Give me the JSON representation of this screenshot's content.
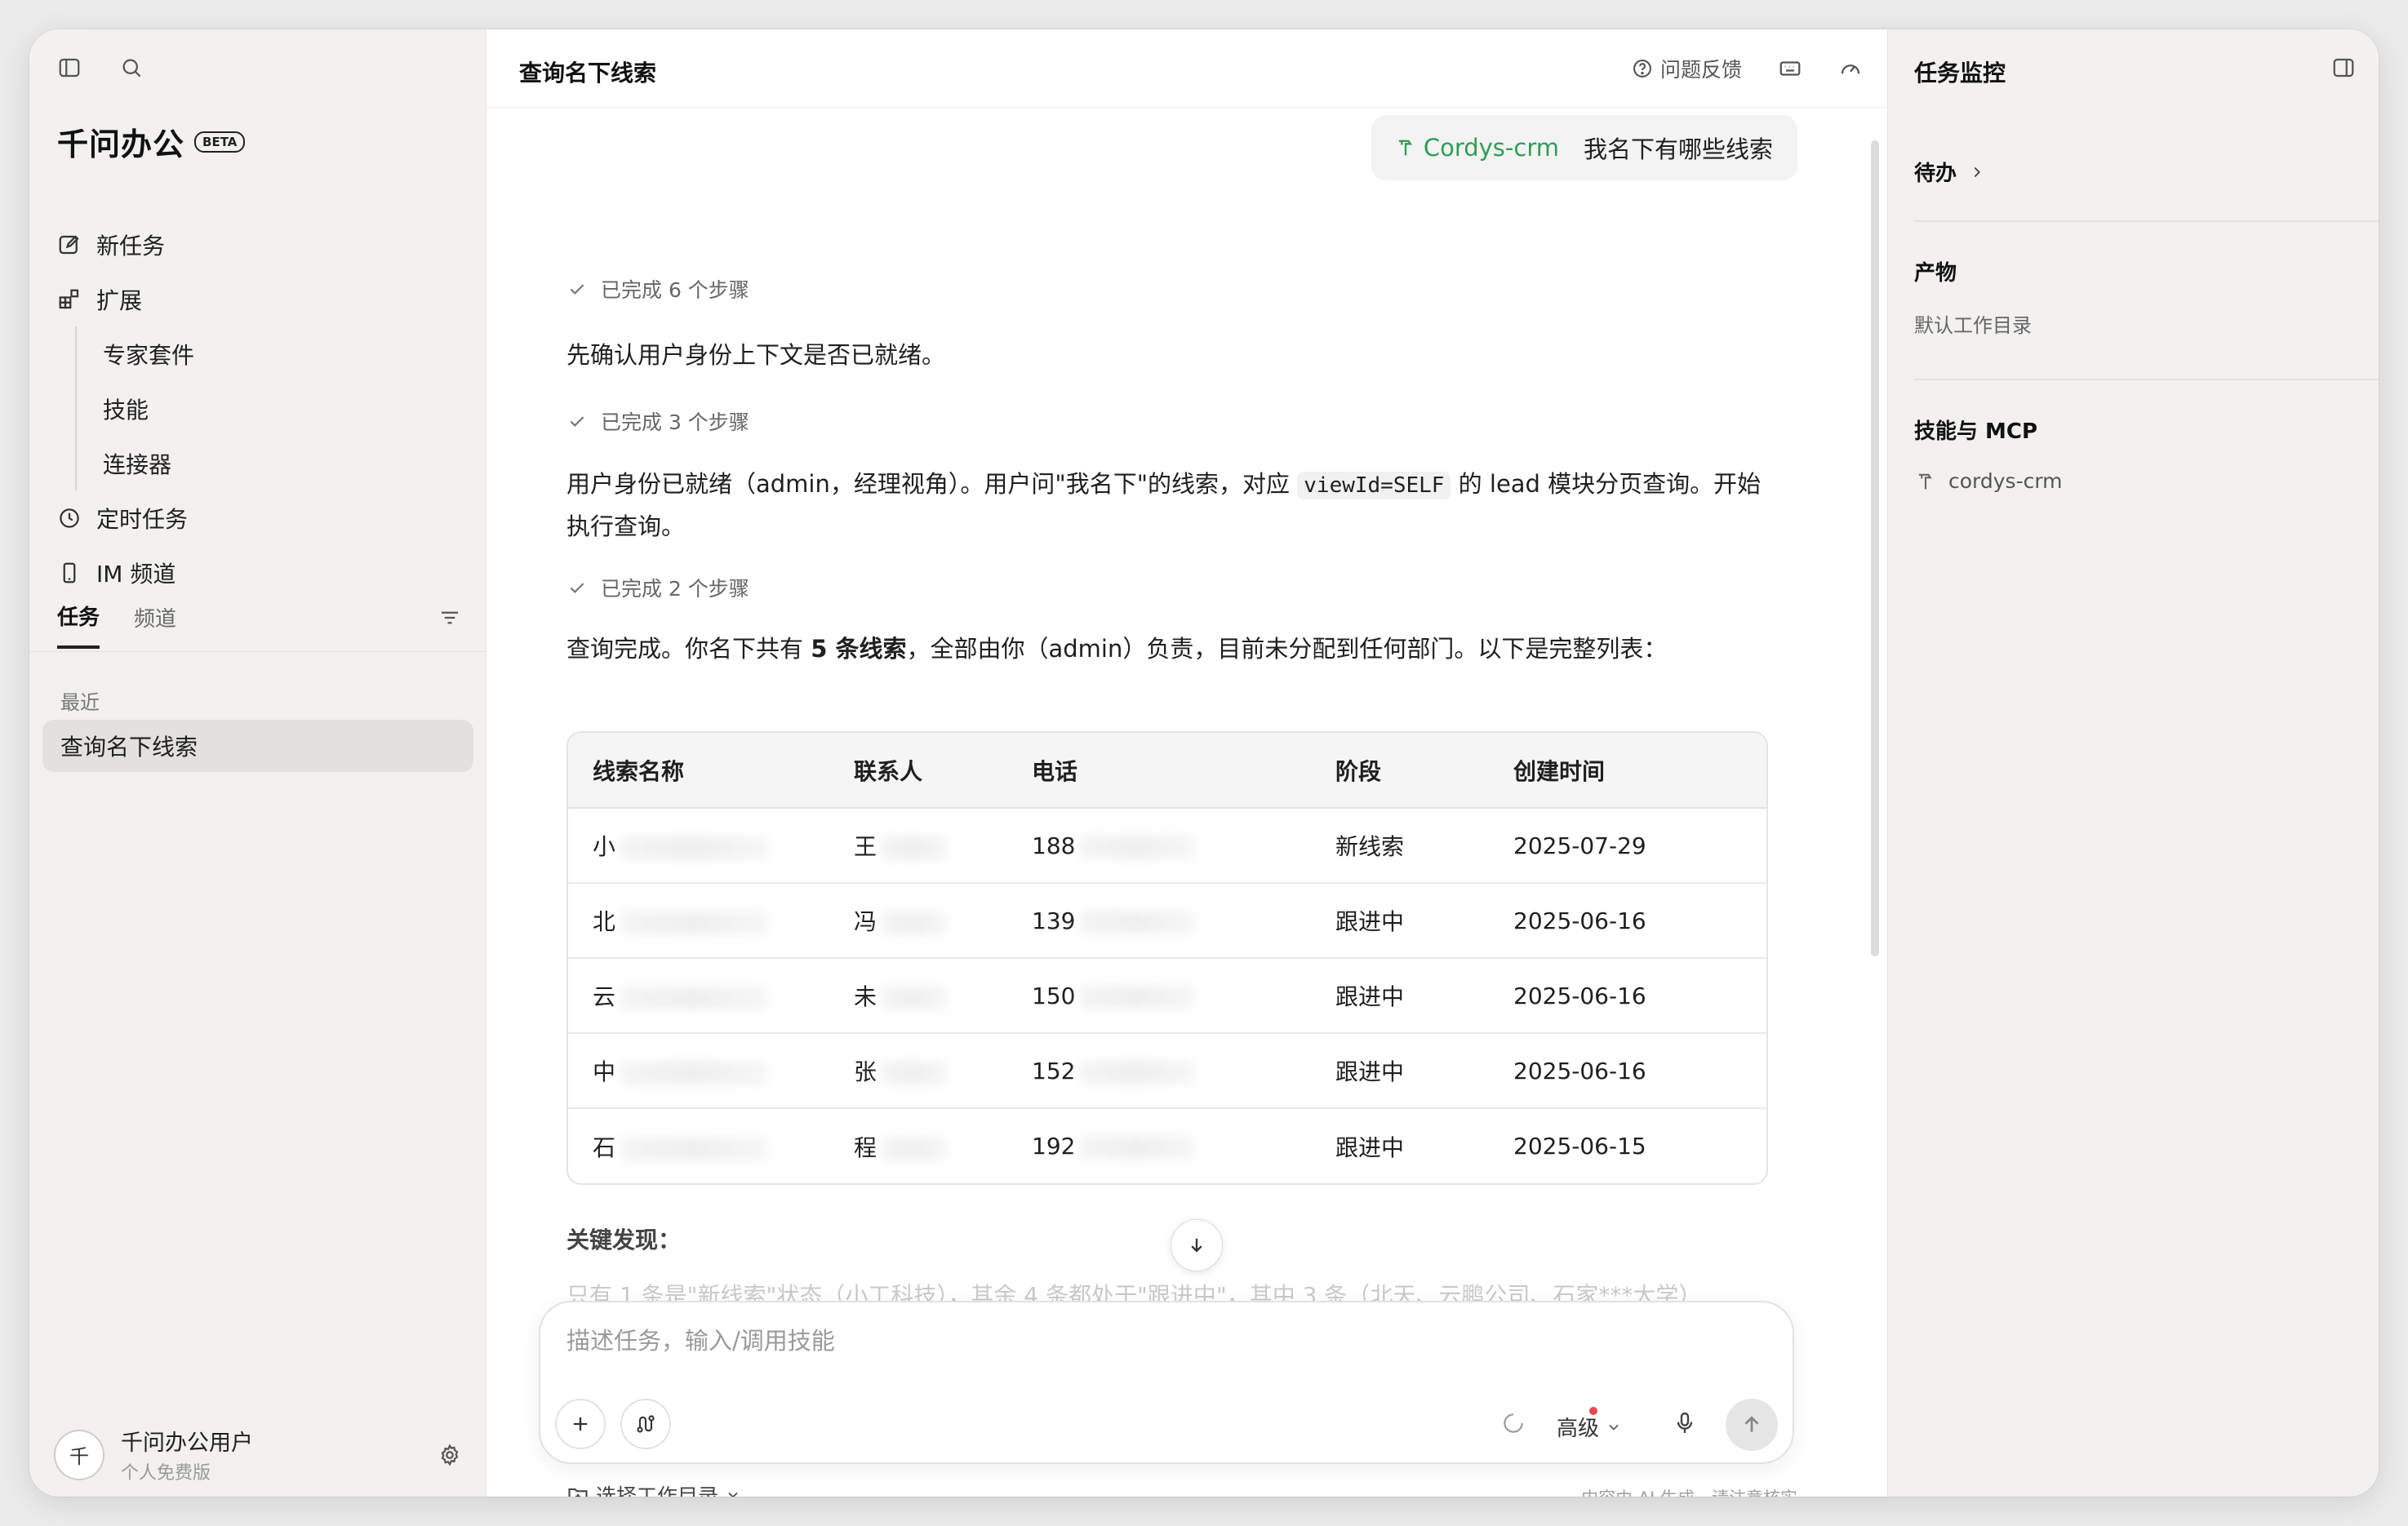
{
  "sidebar": {
    "brand": "千问办公",
    "beta": "BETA",
    "nav": {
      "new_task": "新任务",
      "extensions": "扩展",
      "expert_suite": "专家套件",
      "skills": "技能",
      "connectors": "连接器",
      "scheduled": "定时任务",
      "im_channel": "IM 频道"
    },
    "tabs": {
      "tasks": "任务",
      "channels": "频道"
    },
    "recent_label": "最近",
    "recent_item": "查询名下线索",
    "user": {
      "avatar": "千",
      "name": "千问办公用户",
      "plan": "个人免费版"
    }
  },
  "main": {
    "title": "查询名下线索",
    "feedback": "问题反馈",
    "user_message": {
      "skill": "Cordys-crm",
      "text": "我名下有哪些线索"
    },
    "steps1": "已完成 6 个步骤",
    "para1": "先确认用户身份上下文是否已就绪。",
    "steps2": "已完成 3 个步骤",
    "para2_a": "用户身份已就绪（admin，经理视角）。用户问\"我名下\"的线索，对应 ",
    "para2_code": "viewId=SELF",
    "para2_b": " 的 lead 模块分页查询。开始执行查询。",
    "steps3": "已完成 2 个步骤",
    "para3_a": "查询完成。你名下共有 ",
    "para3_bold": "5 条线索",
    "para3_b": "，全部由你（admin）负责，目前未分配到任何部门。以下是完整列表：",
    "table": {
      "headers": [
        "线索名称",
        "联系人",
        "电话",
        "阶段",
        "创建时间"
      ],
      "rows": [
        [
          "小",
          "王",
          "188",
          "新线索",
          "2025-07-29"
        ],
        [
          "北",
          "冯",
          "139",
          "跟进中",
          "2025-06-16"
        ],
        [
          "云",
          "未",
          "150",
          "跟进中",
          "2025-06-16"
        ],
        [
          "中",
          "张",
          "152",
          "跟进中",
          "2025-06-16"
        ],
        [
          "石",
          "程",
          "192",
          "跟进中",
          "2025-06-15"
        ]
      ]
    },
    "key_findings": "关键发现：",
    "faded_text": "只有 1 条是\"新线索\"状态（小工科技），其余 4 条都处于\"跟进中\"，其中 3 条（北天、云鹏公司、石家***大学）",
    "composer_placeholder": "描述任务，输入/调用技能",
    "mode": "高级",
    "workdir": "选择工作目录",
    "disclaimer": "内容由 AI 生成，请注意核实"
  },
  "right_panel": {
    "title": "任务监控",
    "todo": "待办",
    "artifacts": "产物",
    "default_dir": "默认工作目录",
    "skills_mcp": "技能与 MCP",
    "skill_item": "cordys-crm"
  },
  "colors": {
    "accent_green": "#2e9e55",
    "status_dot": "#e5484d"
  }
}
